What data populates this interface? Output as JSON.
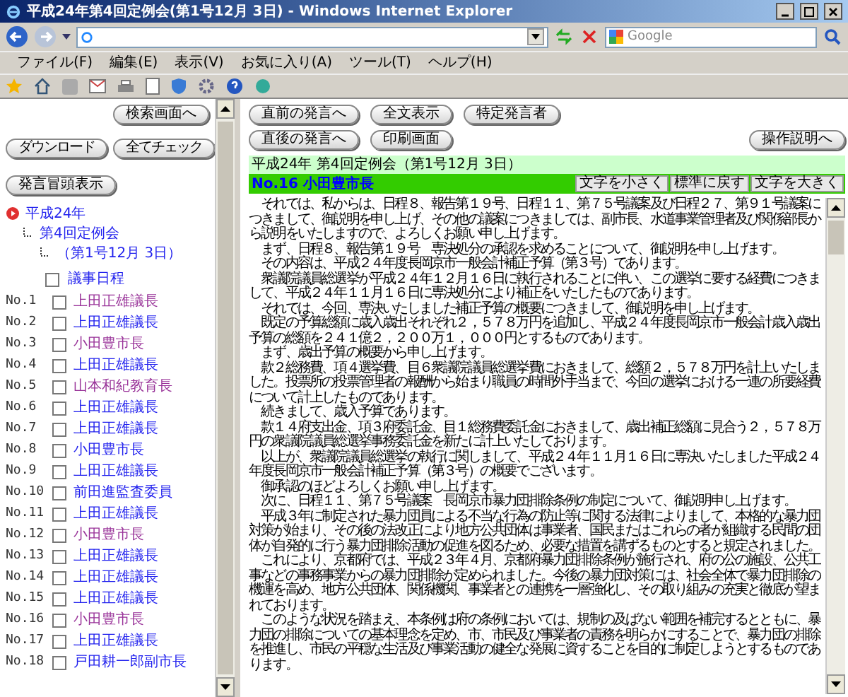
{
  "window": {
    "title": "平成24年第4回定例会(第1号12月 3日) - Windows Internet Explorer"
  },
  "search": {
    "placeholder": "Google"
  },
  "menu": [
    "ファイル(F)",
    "編集(E)",
    "表示(V)",
    "お気に入り(A)",
    "ツール(T)",
    "ヘルプ(H)"
  ],
  "left": {
    "search_button": "検索画面へ",
    "buttons": [
      "ダウンロード",
      "全てチェック"
    ],
    "head_button": "発言冒頭表示",
    "tree": {
      "label": "平成24年",
      "children": [
        {
          "label": "第4回定例会",
          "children": [
            {
              "label": "（第1号12月 3日）"
            }
          ]
        }
      ]
    },
    "agenda": {
      "label": "議事日程",
      "checked": false,
      "visited": false
    },
    "speakers": [
      {
        "no": "No.1",
        "name": "上田正雄議長",
        "checked": false,
        "visited": true
      },
      {
        "no": "No.2",
        "name": "上田正雄議長",
        "checked": false,
        "visited": false
      },
      {
        "no": "No.3",
        "name": "小田豊市長",
        "checked": false,
        "visited": true
      },
      {
        "no": "No.4",
        "name": "上田正雄議長",
        "checked": false,
        "visited": false
      },
      {
        "no": "No.5",
        "name": "山本和紀教育長",
        "checked": false,
        "visited": true
      },
      {
        "no": "No.6",
        "name": "上田正雄議長",
        "checked": false,
        "visited": false
      },
      {
        "no": "No.7",
        "name": "上田正雄議長",
        "checked": false,
        "visited": false
      },
      {
        "no": "No.8",
        "name": "小田豊市長",
        "checked": false,
        "visited": false
      },
      {
        "no": "No.9",
        "name": "上田正雄議長",
        "checked": false,
        "visited": false
      },
      {
        "no": "No.10",
        "name": "前田進監査委員",
        "checked": false,
        "visited": false
      },
      {
        "no": "No.11",
        "name": "上田正雄議長",
        "checked": false,
        "visited": false
      },
      {
        "no": "No.12",
        "name": "小田豊市長",
        "checked": false,
        "visited": true
      },
      {
        "no": "No.13",
        "name": "上田正雄議長",
        "checked": false,
        "visited": false
      },
      {
        "no": "No.14",
        "name": "上田正雄議長",
        "checked": false,
        "visited": false
      },
      {
        "no": "No.15",
        "name": "上田正雄議長",
        "checked": false,
        "visited": false
      },
      {
        "no": "No.16",
        "name": "小田豊市長",
        "checked": false,
        "visited": true
      },
      {
        "no": "No.17",
        "name": "上田正雄議長",
        "checked": false,
        "visited": false
      },
      {
        "no": "No.18",
        "name": "戸田耕一郎副市長",
        "checked": false,
        "visited": false
      }
    ]
  },
  "right": {
    "nav_row_1": [
      "直前の発言へ",
      "全文表示",
      "特定発言者"
    ],
    "nav_row_2": [
      "直後の発言へ",
      "印刷画面"
    ],
    "help_button": "操作説明へ",
    "session_title": "平成24年 第4回定例会（第1号12月 3日）",
    "speaker": "No.16 小田豊市長",
    "size_buttons": [
      "文字を小さく",
      "標準に戻す",
      "文字を大きく"
    ],
    "paragraphs": [
      "　それでは、私からは、日程８、報告第１９号、日程１１、第７５号議案及び日程２７、第９１号議案につきまして、御説明を申し上げ、その他の議案につきましては、副市長、水道事業管理者及び関係部長から説明をいたしますので、よろしくお願い申し上げます。",
      "　まず、日程８、報告第１９号　専決処分の承認を求めることについて、御説明を申し上げます。",
      "　その内容は、平成２４年度長岡京市一般会計補正予算（第３号）であります。",
      "　衆議院議員総選挙が平成２４年１２月１６日に執行されることに伴い、この選挙に要する経費につきまして、平成２４年１１月１６日に専決処分により補正をいたしたものであります。",
      "　それでは、今回、専決いたしました補正予算の概要につきまして、御説明を申し上げます。",
      "　既定の予算総額に歳入歳出それぞれ２，５７８万円を追加し、平成２４年度長岡京市一般会計歳入歳出予算の総額を２４１億２，２００万１，０００円とするものであります。",
      "　まず、歳出予算の概要から申し上げます。",
      "　款２総務費、項４選挙費、目６衆議院議員総選挙費におきまして、総額２，５７８万円を計上いたしました。投票所の投票管理者の報酬から始まり職員の時間外手当まで、今回の選挙における一連の所要経費について計上したものであります。",
      "　続きまして、歳入予算であります。",
      "　款１４府支出金、項３府委託金、目１総務費委託金におきまして、歳出補正総額に見合う２，５７８万円の衆議院議員総選挙事務委託金を新たに計上いたしております。",
      "　以上が、衆議院議員総選挙の執行に関しまして、平成２４年１１月１６日に専決いたしました平成２４年度長岡京市一般会計補正予算（第３号）の概要でございます。",
      "　御承認のほどよろしくお願い申し上げます。",
      "　次に、日程１１、第７５号議案　長岡京市暴力団排除条例の制定について、御説明申し上げます。",
      "　平成３年に制定された暴力団員による不当な行為の防止等に関する法律によりまして、本格的な暴力団対策が始まり、その後の法改正により地方公共団体は事業者、国民またはこれらの者が組織する民間の団体が自発的に行う暴力団排除活動の促進を図るため、必要な措置を講ずるものとすると規定されました。",
      "　これにより、京都府では、平成２３年４月、京都府暴力団排除条例が施行され、府の公の施設、公共工事などの事務事業からの暴力団排除が定められました。今後の暴力団対策には、社会全体で暴力団排除の機運を高め、地方公共団体、関係機関、事業者との連携を一層強化し、その取り組みの充実と徹底が望まれております。",
      "　このような状況を踏まえ、本条例は府の条例においては、規制の及ばない範囲を補完するとともに、暴力団の排除についての基本理念を定め、市、市民及び事業者の責務を明らかにすることで、暴力団の排除を推進し、市民の平穏な生活及び事業活動の健全な発展に資することを目的に制定しようとするものであります。"
    ]
  }
}
